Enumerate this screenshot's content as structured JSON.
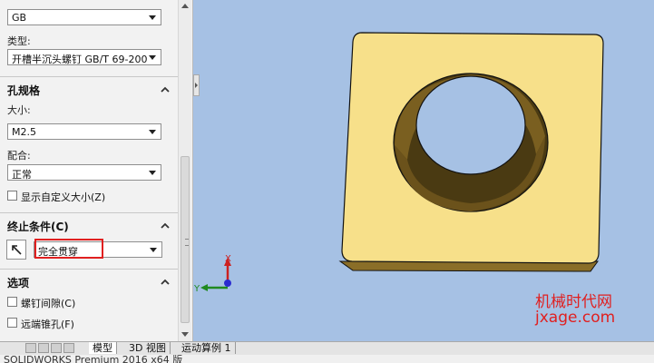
{
  "panel": {
    "standard_value": "GB",
    "type_label": "类型:",
    "type_value": "开槽半沉头螺钉 GB/T 69-200",
    "hole_spec": {
      "title": "孔规格",
      "size_label": "大小:",
      "size_value": "M2.5",
      "fit_label": "配合:",
      "fit_value": "正常",
      "custom_size_label": "显示自定义大小(Z)"
    },
    "end_condition": {
      "title": "终止条件(C)",
      "value": "完全贯穿"
    },
    "options": {
      "title": "选项",
      "screw_clearance_label": "螺钉间隙(C)",
      "far_side_countersink_label": "远端锥孔(F)"
    }
  },
  "viewport": {
    "axis_x": "X",
    "axis_y": "Y",
    "watermark_line1": "机械时代网",
    "watermark_line2": "jxage.com",
    "part_color": "#f7e08a",
    "background_color": "#a6c1e4"
  },
  "tabs": [
    {
      "label": "模型"
    },
    {
      "label": "3D 视图"
    },
    {
      "label": "运动算例 1"
    }
  ],
  "status": {
    "text": "SOLIDWORKS Premium 2016 x64 版"
  },
  "colors": {
    "highlight": "#e02020"
  }
}
